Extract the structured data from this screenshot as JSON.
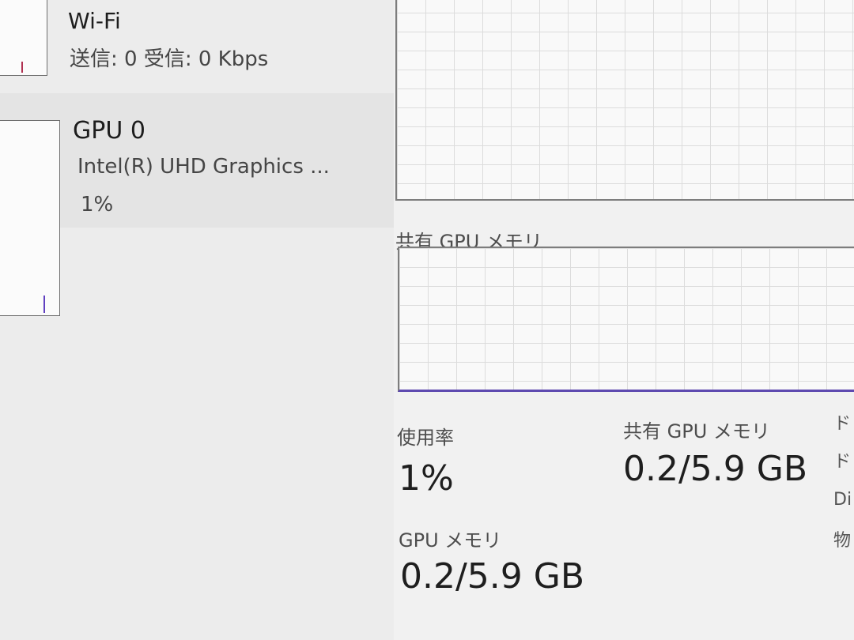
{
  "sidebar": {
    "wifi": {
      "title": "Wi-Fi",
      "subtitle": "送信: 0 受信: 0 Kbps"
    },
    "gpu": {
      "title": "GPU 0",
      "subtitle": "Intel(R) UHD Graphics ...",
      "usage": "1%"
    }
  },
  "graphs": {
    "shared_gpu_memory_title": "共有 GPU メモリ"
  },
  "stats": {
    "usage_label": "使用率",
    "usage_value": "1%",
    "gpu_memory_label": "GPU メモリ",
    "gpu_memory_value": "0.2/5.9 GB",
    "shared_gpu_memory_label": "共有 GPU メモリ",
    "shared_gpu_memory_value": "0.2/5.9 GB",
    "cut_off": [
      "ド",
      "ド",
      "Di",
      "物"
    ]
  },
  "colors": {
    "accent": "#5e4ab0",
    "wifi_spike": "#b03050",
    "gpu_spike": "#6040c0"
  }
}
